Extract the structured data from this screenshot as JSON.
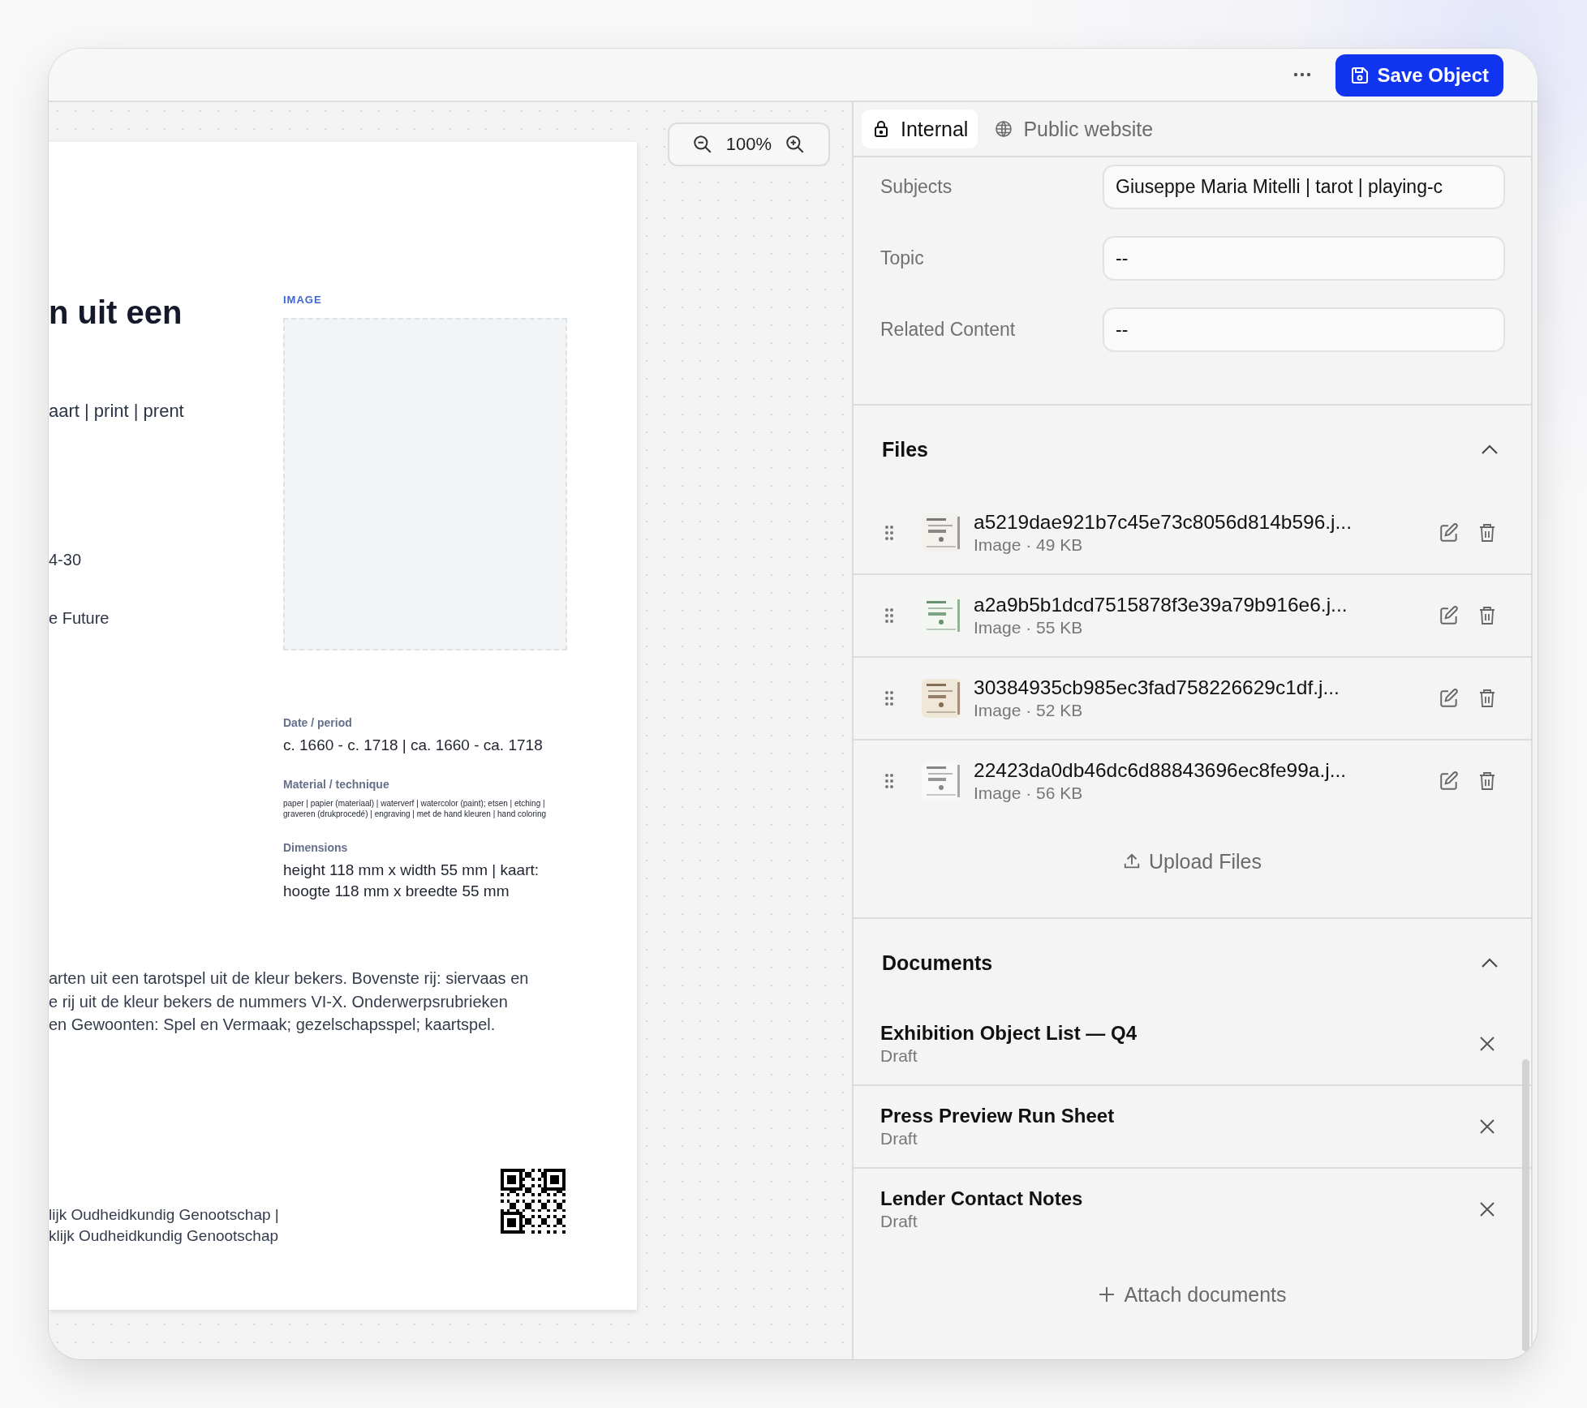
{
  "toolbar": {
    "save_button": "Save Object"
  },
  "zoom": {
    "value": "100%"
  },
  "document": {
    "title": "n uit een",
    "subjects": "aart | print | prent",
    "number": "4-30",
    "exhibition": "e Future",
    "image_label": "IMAGE",
    "facts": [
      {
        "label": "Date / period",
        "value": "c. 1660 - c. 1718 | ca. 1660 - ca. 1718",
        "kind": "normal"
      },
      {
        "label": "Material / technique",
        "value": "paper | papier (materiaal) | waterverf | watercolor (paint); etsen | etching | graveren (drukprocedé) | engraving | met de hand kleuren | hand coloring",
        "kind": "small"
      },
      {
        "label": "Dimensions",
        "value": "height 118 mm x width 55 mm | kaart: hoogte 118 mm x breedte 55 mm",
        "kind": "normal"
      }
    ],
    "description_lines": [
      "arten uit een tarotspel uit de kleur bekers. Bovenste rij: siervaas en",
      "e rij uit de kleur bekers de nummers VI-X. Onderwerpsrubrieken",
      "en Gewoonten: Spel en Vermaak; gezelschapsspel; kaartspel."
    ],
    "credit_lines": [
      "lijk Oudheidkundig Genootschap |",
      "klijk Oudheidkundig Genootschap"
    ]
  },
  "tabs": [
    {
      "label": "Internal",
      "kind": "lock",
      "selected": true
    },
    {
      "label": "Public website",
      "kind": "globe",
      "selected": false
    }
  ],
  "fields": [
    {
      "label": "Subjects",
      "value": "Giuseppe Maria Mitelli | tarot | playing-c"
    },
    {
      "label": "Topic",
      "value": "--"
    },
    {
      "label": "Related Content",
      "value": "--"
    }
  ],
  "files": {
    "title": "Files",
    "expanded": true,
    "upload_button": "Upload Files",
    "items": [
      {
        "name": "a5219dae921b7c45e73c8056d814b596.j...",
        "meta": "Image · 49 KB"
      },
      {
        "name": "a2a9b5b1dcd7515878f3e39a79b916e6.j...",
        "meta": "Image · 55 KB"
      },
      {
        "name": "30384935cb985ec3fad758226629c1df.j...",
        "meta": "Image · 52 KB"
      },
      {
        "name": "22423da0db46dc6d88843696ec8fe99a.j...",
        "meta": "Image · 56 KB"
      }
    ]
  },
  "documents": {
    "title": "Documents",
    "expanded": true,
    "attach_button": "Attach documents",
    "items": [
      {
        "title": "Exhibition Object List — Q4",
        "status": "Draft"
      },
      {
        "title": "Press Preview Run Sheet",
        "status": "Draft"
      },
      {
        "title": "Lender Contact Notes",
        "status": "Draft"
      }
    ]
  }
}
